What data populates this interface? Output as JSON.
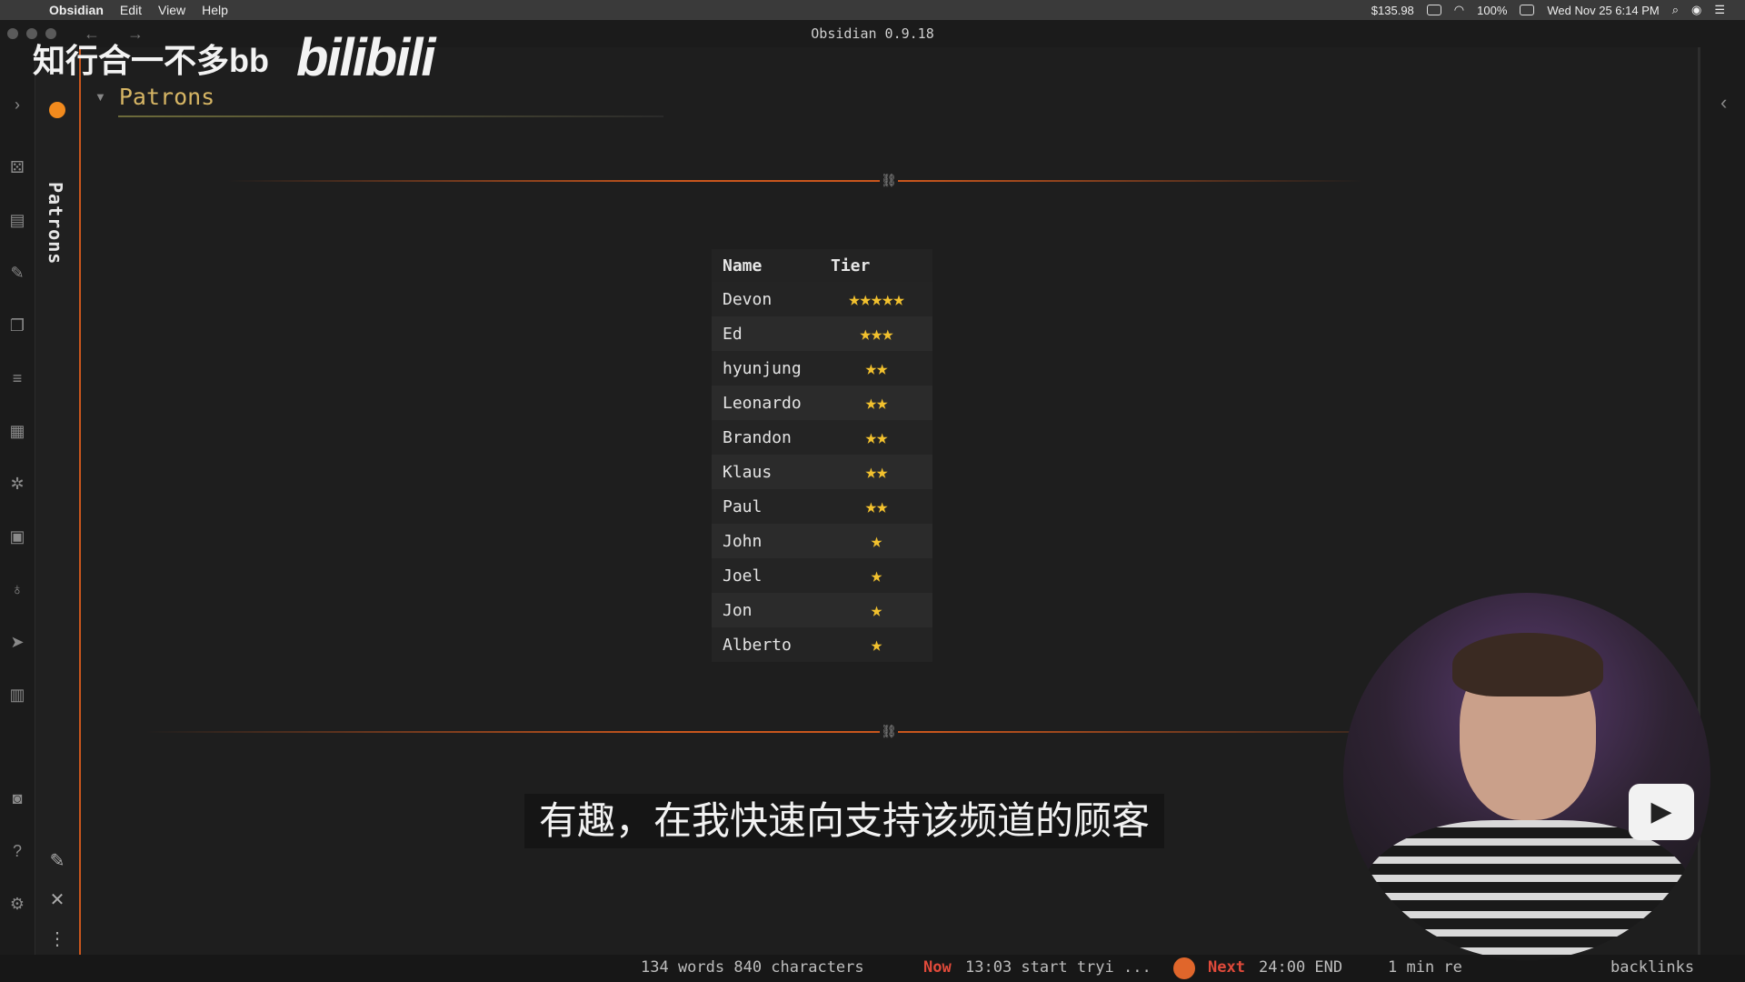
{
  "menubar": {
    "app_name": "Obsidian",
    "menus": [
      "Edit",
      "View",
      "Help"
    ],
    "price": "$135.98",
    "battery": "100%",
    "datetime": "Wed Nov 25  6:14 PM"
  },
  "window": {
    "title": "Obsidian 0.9.18"
  },
  "tab": {
    "label": "Patrons"
  },
  "document": {
    "heading": "Patrons",
    "table": {
      "headers": [
        "Name",
        "Tier"
      ],
      "rows": [
        {
          "name": "Devon",
          "stars": 5,
          "tier": "★★★★★"
        },
        {
          "name": "Ed",
          "stars": 3,
          "tier": "★★★"
        },
        {
          "name": "hyunjung",
          "stars": 2,
          "tier": "★★"
        },
        {
          "name": "Leonardo",
          "stars": 2,
          "tier": "★★"
        },
        {
          "name": "Brandon",
          "stars": 2,
          "tier": "★★"
        },
        {
          "name": "Klaus",
          "stars": 2,
          "tier": "★★"
        },
        {
          "name": "Paul",
          "stars": 2,
          "tier": "★★"
        },
        {
          "name": "John",
          "stars": 1,
          "tier": "★"
        },
        {
          "name": "Joel",
          "stars": 1,
          "tier": "★"
        },
        {
          "name": "Jon",
          "stars": 1,
          "tier": "★"
        },
        {
          "name": "Alberto",
          "stars": 1,
          "tier": "★"
        }
      ]
    }
  },
  "statusbar": {
    "counts": "134 words 840 characters",
    "now_label": "Now",
    "now_text": "13:03 start tryi ...",
    "next_label": "Next",
    "next_text": "24:00 END",
    "reading": "1 min re",
    "backlinks": "backlinks"
  },
  "overlay": {
    "watermark": "知行合一不多bb",
    "logo": "bilibili",
    "subtitle": "有趣，在我快速向支持该频道的顾客"
  },
  "colors": {
    "accent": "#c9561d",
    "heading": "#d6b564",
    "star": "#f2c12e",
    "now_next": "#e04a3a"
  }
}
